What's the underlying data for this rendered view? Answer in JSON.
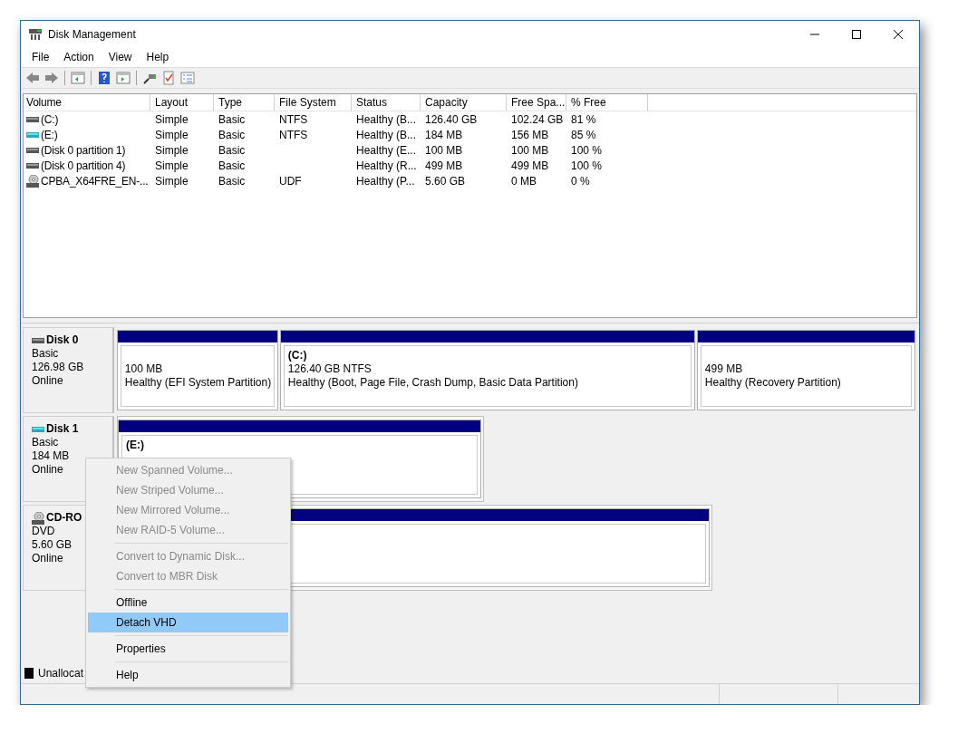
{
  "window": {
    "title": "Disk Management"
  },
  "menu": [
    {
      "label": "File"
    },
    {
      "label": "Action"
    },
    {
      "label": "View"
    },
    {
      "label": "Help"
    }
  ],
  "toolbar": [
    {
      "kind": "back"
    },
    {
      "kind": "forward"
    },
    {
      "kind": "separator"
    },
    {
      "kind": "tree"
    },
    {
      "kind": "separator"
    },
    {
      "kind": "help"
    },
    {
      "kind": "pane"
    },
    {
      "kind": "separator"
    },
    {
      "kind": "connect"
    },
    {
      "kind": "check"
    },
    {
      "kind": "list"
    }
  ],
  "volumes": {
    "columns": [
      "Volume",
      "Layout",
      "Type",
      "File System",
      "Status",
      "Capacity",
      "Free Spa...",
      "% Free"
    ],
    "rows": [
      {
        "kind": "disk",
        "cells": [
          "(C:)",
          "Simple",
          "Basic",
          "NTFS",
          "Healthy (B...",
          "126.40 GB",
          "102.24 GB",
          "81 %"
        ]
      },
      {
        "kind": "virtual",
        "cells": [
          "(E:)",
          "Simple",
          "Basic",
          "NTFS",
          "Healthy (B...",
          "184 MB",
          "156 MB",
          "85 %"
        ]
      },
      {
        "kind": "disk",
        "cells": [
          "(Disk 0 partition 1)",
          "Simple",
          "Basic",
          null,
          "Healthy (E...",
          "100 MB",
          "100 MB",
          "100 %"
        ]
      },
      {
        "kind": "disk",
        "cells": [
          "(Disk 0 partition 4)",
          "Simple",
          "Basic",
          null,
          "Healthy (R...",
          "499 MB",
          "499 MB",
          "100 %"
        ]
      },
      {
        "kind": "optical",
        "cells": [
          "CPBA_X64FRE_EN-...",
          "Simple",
          "Basic",
          "UDF",
          "Healthy (P...",
          "5.60 GB",
          "0 MB",
          "0 %"
        ]
      }
    ]
  },
  "disks": [
    {
      "kind": "disk",
      "name": "Disk 0",
      "type": "Basic",
      "size": "126.98 GB",
      "status": "Online",
      "partitions": [
        {
          "kind": "primary",
          "size": "100 MB",
          "status": "Healthy (EFI System Partition)"
        },
        {
          "kind": "primary",
          "label": "(C:)",
          "size": "126.40 GB NTFS",
          "status": "Healthy (Boot, Page File, Crash Dump, Basic Data Partition)"
        },
        {
          "kind": "primary",
          "size": "499 MB",
          "status": "Healthy (Recovery Partition)"
        }
      ]
    },
    {
      "kind": "virtual",
      "name": "Disk 1",
      "type": "Basic",
      "size": "184 MB",
      "status": "Online",
      "partitions": [
        {
          "kind": "primary",
          "label": "(E:)"
        }
      ]
    },
    {
      "kind": "optical",
      "name": "CD-RO",
      "type": "DVD",
      "size": "5.60 GB",
      "status": "Online",
      "partitions": [
        {
          "kind": "primary"
        }
      ]
    }
  ],
  "legend": [
    {
      "label": "Unallocat",
      "color": "#000000"
    }
  ],
  "context_menu": [
    {
      "kind": "item",
      "label": "New Spanned Volume...",
      "disabled": true,
      "selected": false
    },
    {
      "kind": "item",
      "label": "New Striped Volume...",
      "disabled": true,
      "selected": false
    },
    {
      "kind": "item",
      "label": "New Mirrored Volume...",
      "disabled": true,
      "selected": false
    },
    {
      "kind": "item",
      "label": "New RAID-5 Volume...",
      "disabled": true,
      "selected": false
    },
    {
      "kind": "separator"
    },
    {
      "kind": "item",
      "label": "Convert to Dynamic Disk...",
      "disabled": true,
      "selected": false
    },
    {
      "kind": "item",
      "label": "Convert to MBR Disk",
      "disabled": true,
      "selected": false
    },
    {
      "kind": "separator"
    },
    {
      "kind": "item",
      "label": "Offline",
      "disabled": false,
      "selected": false
    },
    {
      "kind": "item",
      "label": "Detach VHD",
      "disabled": false,
      "selected": true
    },
    {
      "kind": "separator"
    },
    {
      "kind": "item",
      "label": "Properties",
      "disabled": false,
      "selected": false
    },
    {
      "kind": "separator"
    },
    {
      "kind": "item",
      "label": "Help",
      "disabled": false,
      "selected": false
    }
  ]
}
